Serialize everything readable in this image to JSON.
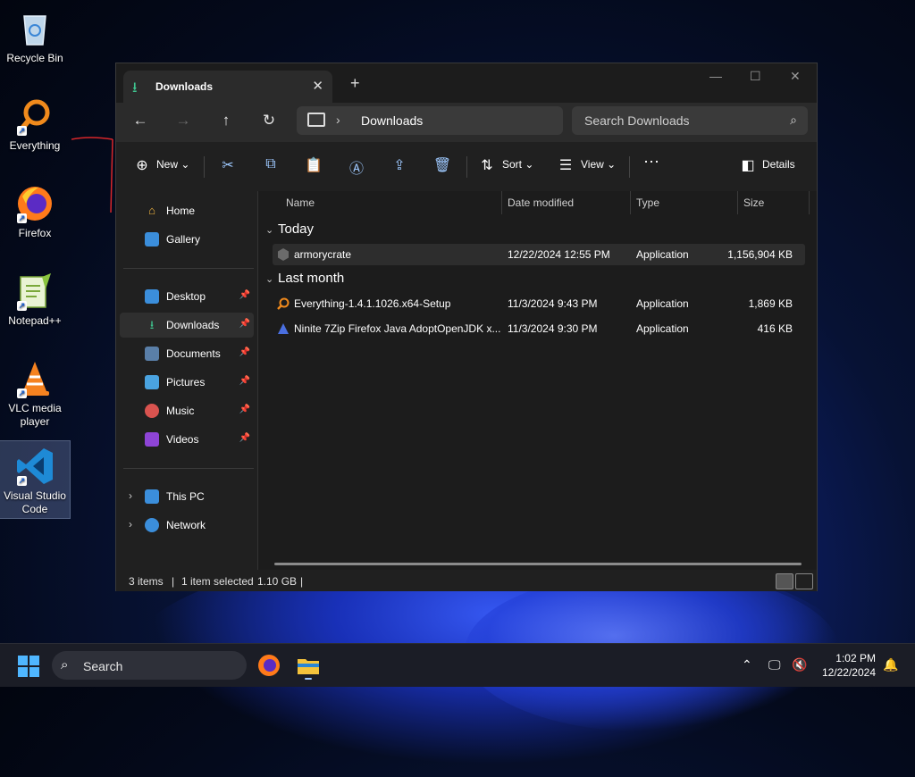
{
  "desktop": {
    "icons": [
      {
        "label": "Recycle Bin",
        "icon": "recycle-bin-icon"
      },
      {
        "label": "Everything",
        "icon": "everything-search-icon"
      },
      {
        "label": "Firefox",
        "icon": "firefox-icon"
      },
      {
        "label": "Notepad++",
        "icon": "notepad-plus-plus-icon"
      },
      {
        "label": "VLC media player",
        "icon": "vlc-icon"
      },
      {
        "label": "Visual Studio Code",
        "icon": "vscode-icon"
      }
    ]
  },
  "window": {
    "tab_title": "Downloads",
    "address": {
      "location": "Downloads"
    },
    "search": {
      "placeholder": "Search Downloads"
    },
    "commands": {
      "new_label": "New",
      "sort_label": "Sort",
      "view_label": "View",
      "more_label": "⋯",
      "details_label": "Details"
    },
    "sidebar": {
      "home": "Home",
      "gallery": "Gallery",
      "quick": [
        "Desktop",
        "Downloads",
        "Documents",
        "Pictures",
        "Music",
        "Videos"
      ],
      "this_pc": "This PC",
      "network": "Network",
      "active": "Downloads"
    },
    "columns": {
      "name": "Name",
      "date": "Date modified",
      "type": "Type",
      "size": "Size"
    },
    "groups": [
      {
        "label": "Today",
        "files": [
          {
            "name": "armorycrate",
            "date": "12/22/2024 12:55 PM",
            "type": "Application",
            "size": "1,156,904 KB",
            "selected": true
          }
        ]
      },
      {
        "label": "Last month",
        "files": [
          {
            "name": "Everything-1.4.1.1026.x64-Setup",
            "date": "11/3/2024 9:43 PM",
            "type": "Application",
            "size": "1,869 KB",
            "selected": false
          },
          {
            "name": "Ninite 7Zip Firefox Java AdoptOpenJDK x...",
            "date": "11/3/2024 9:30 PM",
            "type": "Application",
            "size": "416 KB",
            "selected": false
          }
        ]
      }
    ],
    "status": {
      "items": "3 items",
      "selected": "1 item selected",
      "size": "1.10 GB"
    }
  },
  "taskbar": {
    "search_label": "Search",
    "time": "1:02 PM",
    "date": "12/22/2024"
  },
  "colors": {
    "accent": "#4fb6ff",
    "downloads_green": "#3fc48f",
    "window_bg": "#202020",
    "selection_bg": "#2d2d2d"
  }
}
